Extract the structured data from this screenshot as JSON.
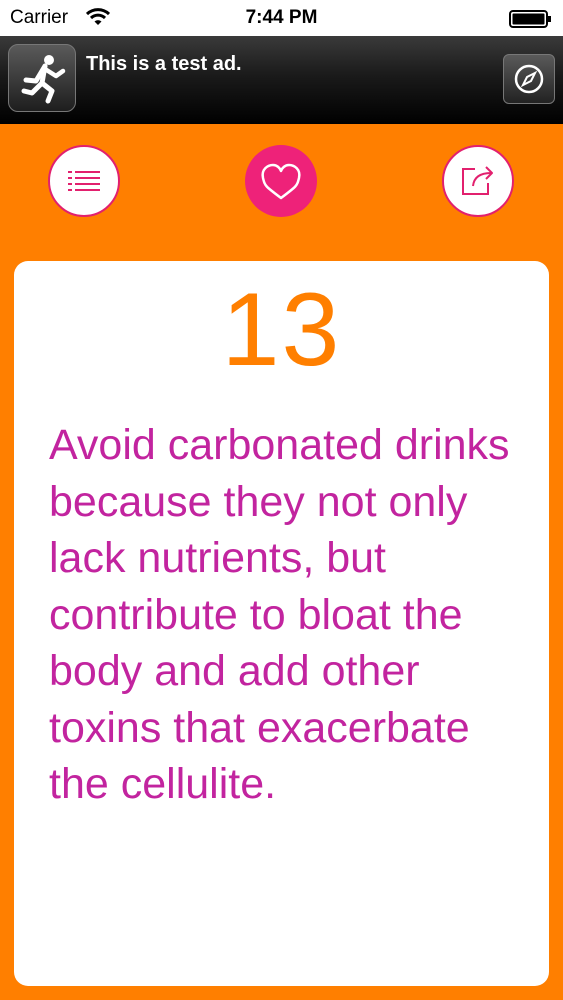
{
  "status_bar": {
    "carrier": "Carrier",
    "time": "7:44 PM",
    "wifi_icon": "wifi-icon",
    "battery_icon": "battery-icon"
  },
  "ad": {
    "text": "This is a test ad.",
    "app_icon": "running-person-icon",
    "compass_icon": "compass-icon"
  },
  "toolbar": {
    "list_icon": "list-icon",
    "heart_icon": "heart-icon",
    "share_icon": "share-icon"
  },
  "tip": {
    "number": "13",
    "text": "Avoid carbonated drinks because they not only lack nutrients, but contribute to bloat the body and add other toxins that exacerbate the cellulite."
  },
  "colors": {
    "background": "#ff7f00",
    "accent_pink": "#ee2279",
    "text_magenta": "#c2249f",
    "number_orange": "#ff7f00"
  }
}
